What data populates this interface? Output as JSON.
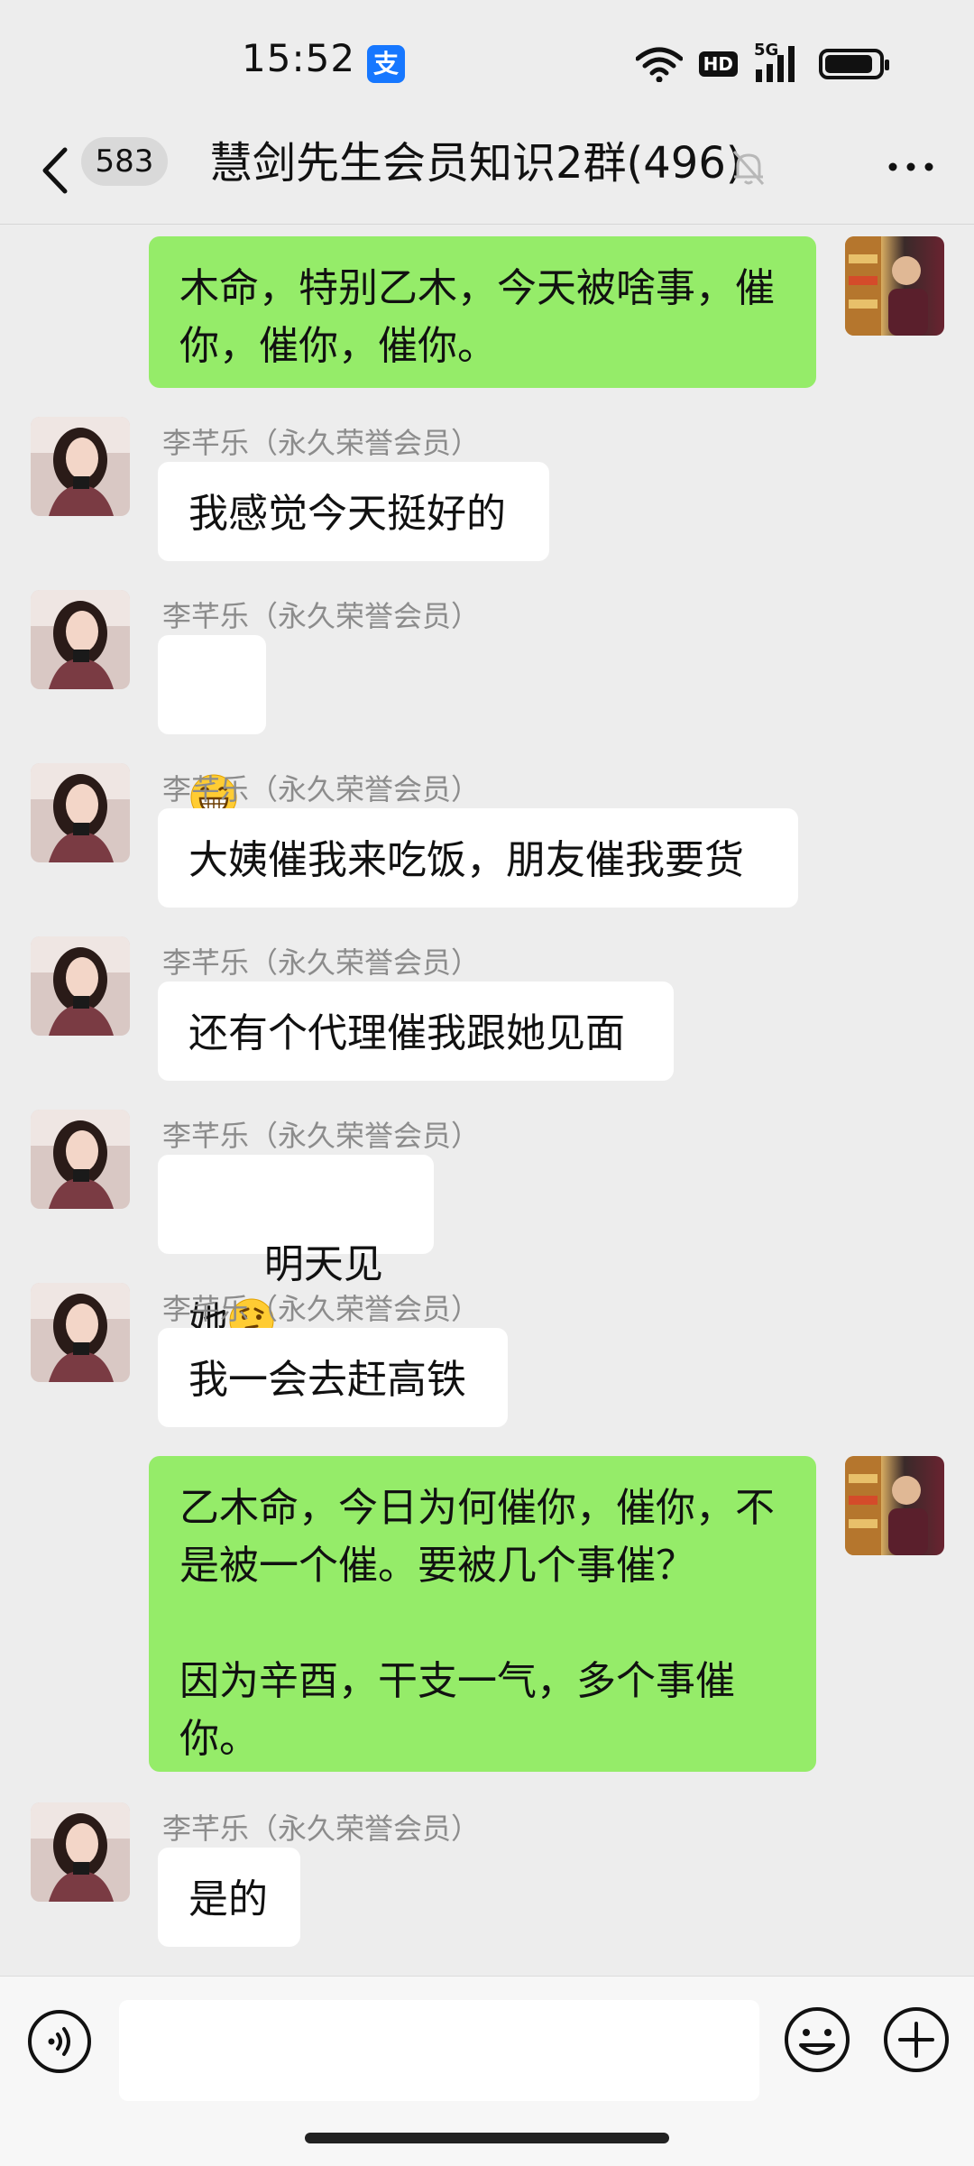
{
  "status_bar": {
    "time": "15:52",
    "alipay_glyph": "支",
    "network": "5G",
    "hd": "HD",
    "battery_level": 0.9
  },
  "header": {
    "unread_count": "583",
    "title": "慧剑先生会员知识2群(496)",
    "icons": [
      "chevron-left-icon",
      "bell-muted-icon",
      "more-icon"
    ]
  },
  "messages": [
    {
      "side": "right",
      "text": "木命，特别乙木，今天被啥事，催\n你，催你，催你。"
    },
    {
      "side": "left",
      "sender": "李芊乐（永久荣誉会员）",
      "text": "我感觉今天挺好的"
    },
    {
      "side": "left",
      "sender": "李芊乐（永久荣誉会员）",
      "text": "",
      "emoji": "grinning-emoji"
    },
    {
      "side": "left",
      "sender": "李芊乐（永久荣誉会员）",
      "text": "大姨催我来吃饭，朋友催我要货"
    },
    {
      "side": "left",
      "sender": "李芊乐（永久荣誉会员）",
      "text": "还有个代理催我跟她见面"
    },
    {
      "side": "left",
      "sender": "李芊乐（永久荣誉会员）",
      "text": "明天见她",
      "emoji": "thinking-emoji"
    },
    {
      "side": "left",
      "sender": "李芊乐（永久荣誉会员）",
      "text": "我一会去赶高铁"
    },
    {
      "side": "right",
      "text": "乙木命，今日为何催你，催你，不\n是被一个催。要被几个事催？\n\n因为辛酉，干支一气，多个事催\n你。"
    },
    {
      "side": "left",
      "sender": "李芊乐（永久荣誉会员）",
      "text": "是的"
    }
  ],
  "input_bar": {
    "placeholder": "",
    "icons": [
      "voice-icon",
      "emoji-icon",
      "plus-icon"
    ]
  }
}
